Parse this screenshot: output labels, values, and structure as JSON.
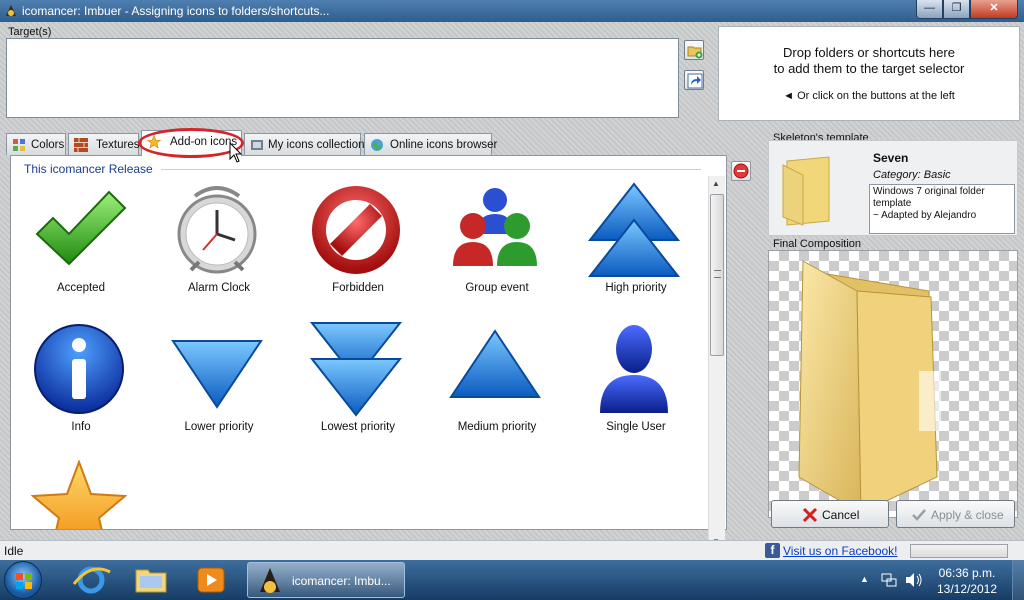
{
  "window": {
    "title": "icomancer: Imbuer - Assigning icons to folders/shortcuts...",
    "minimize": "—",
    "maximize": "❐",
    "close": "✕"
  },
  "targets": {
    "label": "Target(s)"
  },
  "drop_panel": {
    "line1": "Drop folders or shortcuts here",
    "line2": "to add them to the target selector",
    "line3": "◄ Or click on the buttons at the left"
  },
  "tabs": [
    {
      "label": "Colors",
      "icon": "palette-icon"
    },
    {
      "label": "Textures",
      "icon": "brick-icon"
    },
    {
      "label": "Add-on icons",
      "icon": "star-icon",
      "active": true
    },
    {
      "label": "My icons collection",
      "icon": "film-icon"
    },
    {
      "label": "Online icons browser",
      "icon": "globe-icon"
    }
  ],
  "gallery": {
    "group": "This icomancer Release",
    "items": [
      {
        "label": "Accepted",
        "icon": "checkmark-icon"
      },
      {
        "label": "Alarm Clock",
        "icon": "alarm-clock-icon"
      },
      {
        "label": "Forbidden",
        "icon": "forbidden-icon"
      },
      {
        "label": "Group event",
        "icon": "group-icon"
      },
      {
        "label": "High priority",
        "icon": "double-up-arrow-icon"
      },
      {
        "label": "Info",
        "icon": "info-icon"
      },
      {
        "label": "Lower priority",
        "icon": "down-arrow-icon"
      },
      {
        "label": "Lowest priority",
        "icon": "double-down-arrow-icon"
      },
      {
        "label": "Medium priority",
        "icon": "up-arrow-icon"
      },
      {
        "label": "Single User",
        "icon": "user-icon"
      },
      {
        "label": "",
        "icon": "star-icon"
      }
    ]
  },
  "skeleton": {
    "title": "Skeleton's template",
    "name": "Seven",
    "category": "Category: Basic",
    "description_line1": "Windows 7 original folder",
    "description_line2": "template",
    "description_line3": "~ Adapted by Alejandro"
  },
  "final": {
    "title": "Final Composition"
  },
  "buttons": {
    "cancel": "Cancel",
    "apply": "Apply & close"
  },
  "status": {
    "text": "Idle",
    "facebook_link": "Visit us on Facebook!"
  },
  "taskbar": {
    "active_window": "icomancer: Imbu...",
    "time": "06:36 p.m.",
    "date": "13/12/2012"
  },
  "colors": {
    "title_bar": "#3a6796",
    "tab_highlight": "#d4252c",
    "group_header": "#1a3d8f",
    "link": "#0a3ec8",
    "folder": "#f2d67a"
  }
}
